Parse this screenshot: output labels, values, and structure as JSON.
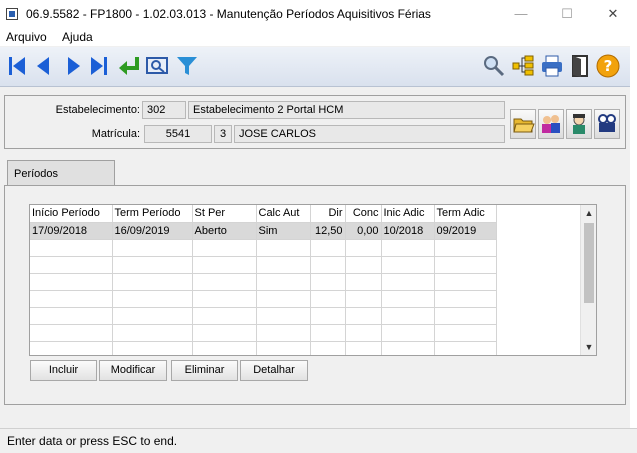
{
  "window": {
    "title": "06.9.5582 - FP1800 - 1.02.03.013 - Manutenção Períodos Aquisitivos Férias",
    "minimize": "—",
    "maximize": "☐",
    "close": "✕"
  },
  "menu": {
    "items": [
      "Arquivo",
      "Ajuda"
    ]
  },
  "toolbar": {
    "buttons": [
      "first-record-icon",
      "previous-record-icon",
      "next-record-icon",
      "last-record-icon",
      "return-icon",
      "goto-icon",
      "filter-icon"
    ],
    "right_buttons": [
      "search-icon",
      "tree-icon",
      "print-icon",
      "exit-icon",
      "help-icon"
    ],
    "accent": "#1b5fd6"
  },
  "header": {
    "estabelecimento_label": "Estabelecimento:",
    "estabelecimento_code": "302",
    "estabelecimento_name": "Estabelecimento 2 Portal HCM",
    "matricula_label": "Matrícula:",
    "matricula_number": "5541",
    "matricula_digit": "3",
    "employee_name": "JOSE CARLOS"
  },
  "tabs": {
    "active": "Períodos"
  },
  "grid": {
    "columns": [
      "Início Período",
      "Term Período",
      "St Per",
      "Calc Aut",
      "Dir",
      "Conc",
      "Inic Adic",
      "Term Adic"
    ],
    "rows": [
      [
        "17/09/2018",
        "16/09/2019",
        "Aberto",
        "Sim",
        "12,50",
        "0,00",
        "10/2018",
        "09/2019"
      ]
    ]
  },
  "buttons": {
    "incluir": "Incluir",
    "modificar": "Modificar",
    "eliminar": "Eliminar",
    "detalhar": "Detalhar"
  },
  "status": {
    "text": "Enter data or press ESC to end."
  }
}
